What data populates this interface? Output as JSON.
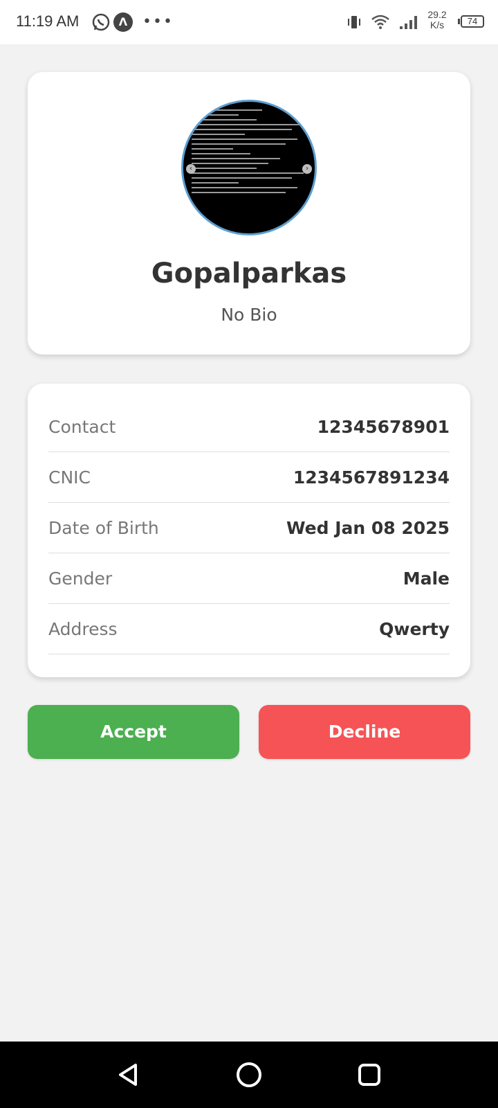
{
  "status_bar": {
    "time": "11:19 AM",
    "net_speed_value": "29.2",
    "net_speed_unit": "K/s",
    "battery": "74"
  },
  "profile": {
    "name": "Gopalparkas",
    "bio": "No Bio"
  },
  "details": [
    {
      "label": "Contact",
      "value": "12345678901"
    },
    {
      "label": "CNIC",
      "value": "1234567891234"
    },
    {
      "label": "Date of Birth",
      "value": "Wed Jan 08 2025"
    },
    {
      "label": "Gender",
      "value": "Male"
    },
    {
      "label": "Address",
      "value": "Qwerty"
    }
  ],
  "actions": {
    "accept": "Accept",
    "decline": "Decline"
  },
  "colors": {
    "accept": "#4caf50",
    "decline": "#f65356",
    "avatar_border": "#5d9ecf",
    "background": "#f2f2f2"
  }
}
